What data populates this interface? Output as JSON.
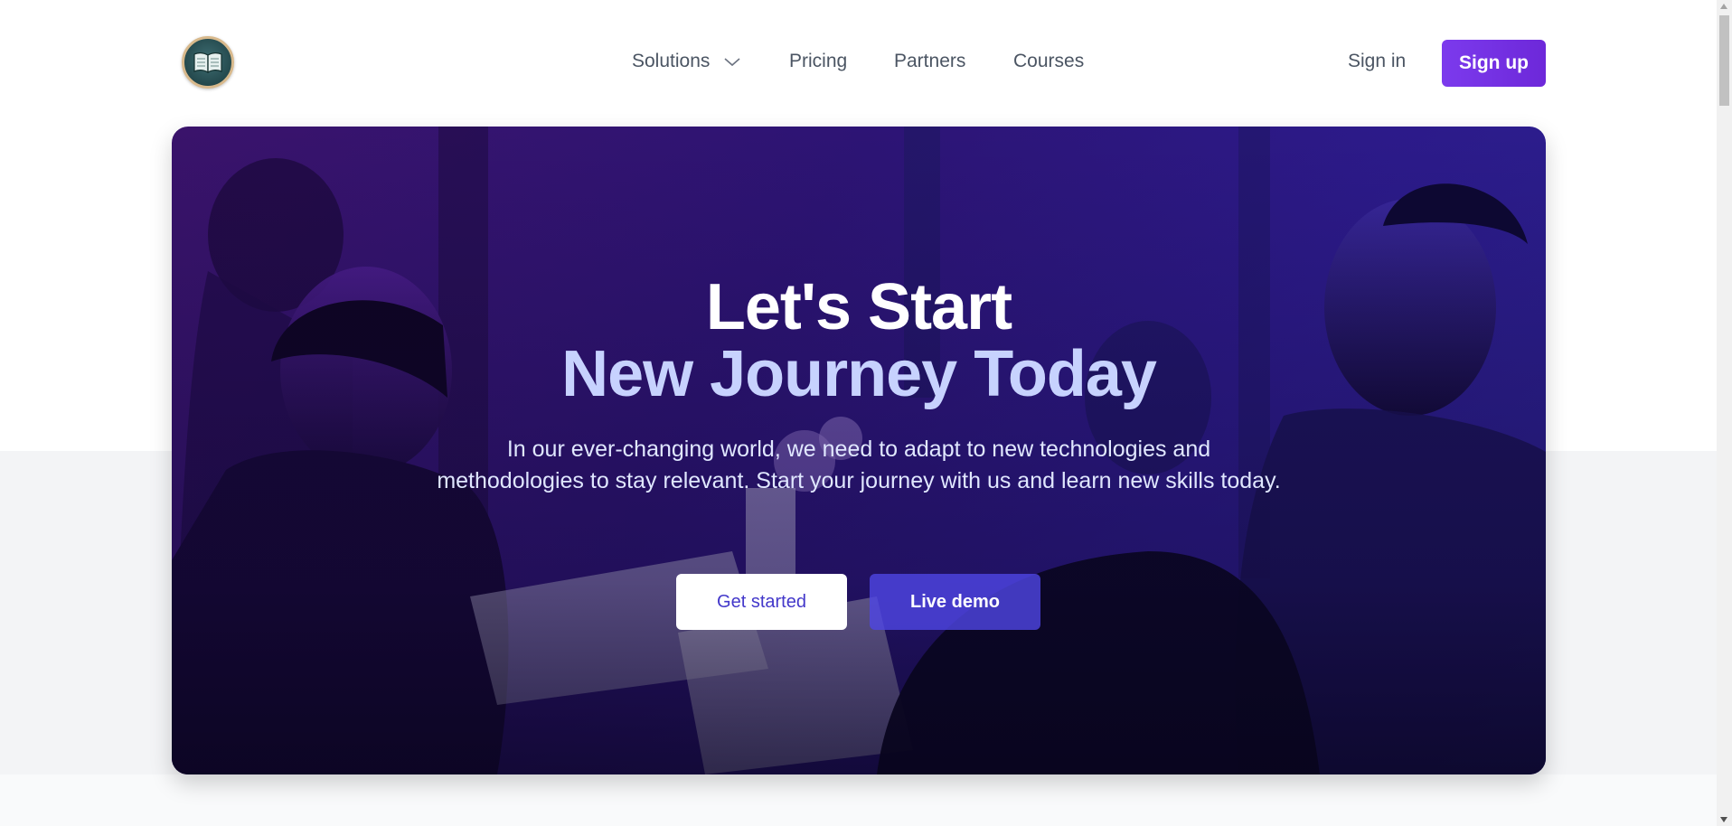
{
  "header": {
    "logo_icon": "open-book-icon",
    "nav": [
      {
        "label": "Solutions",
        "has_dropdown": true,
        "icon": "chevron-down-icon"
      },
      {
        "label": "Pricing"
      },
      {
        "label": "Partners"
      },
      {
        "label": "Courses"
      }
    ],
    "sign_in": "Sign in",
    "sign_up": "Sign up"
  },
  "hero": {
    "title_line1": "Let's Start",
    "title_line2": "New Journey Today",
    "description": "In our ever-changing world, we need to adapt to new technologies and methodologies to stay relevant. Start your journey with us and learn new skills today.",
    "primary_button": "Get started",
    "secondary_button": "Live demo"
  },
  "colors": {
    "brand": "#7c3aed",
    "hero_title_accent": "#c7d2fe",
    "primary_button_text": "#4338ca",
    "secondary_button_bg": "#4f46e5"
  }
}
